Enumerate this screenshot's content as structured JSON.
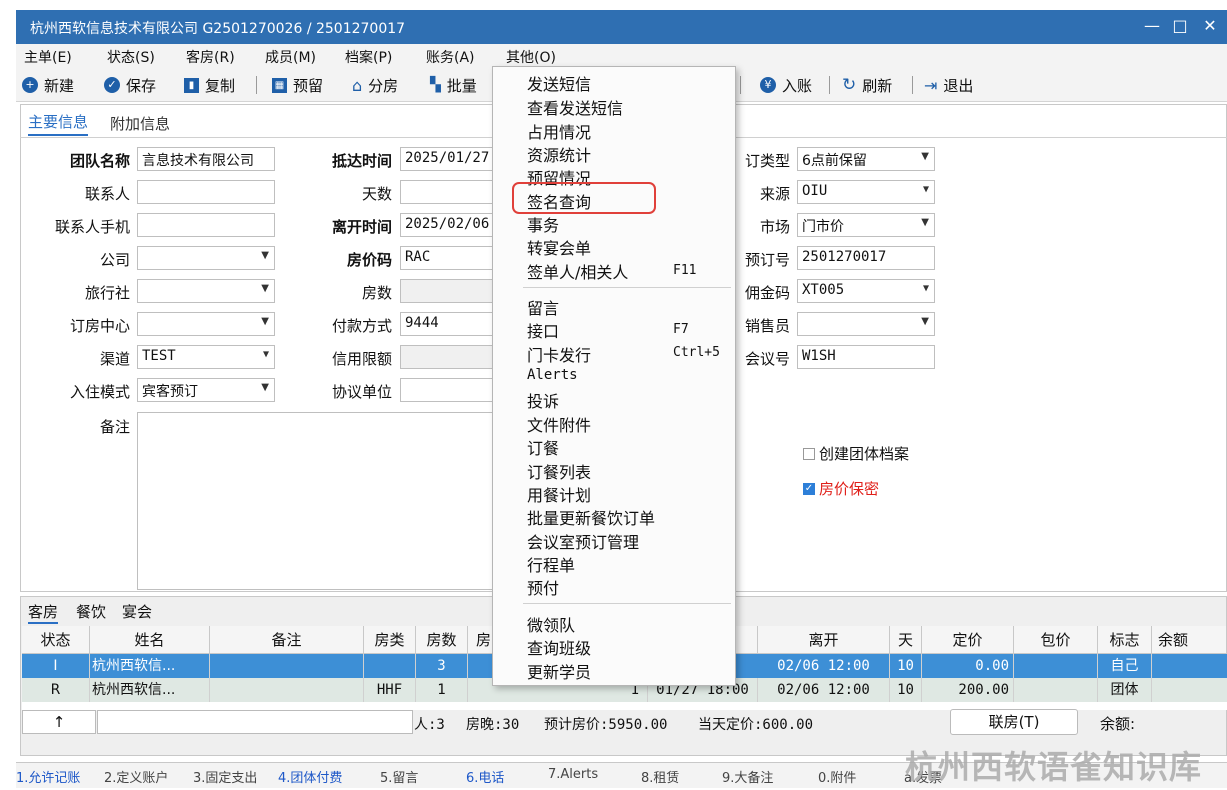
{
  "window": {
    "title": "杭州西软信息技术有限公司  G2501270026 / 2501270017",
    "min": "—",
    "max": "□",
    "close": "✕"
  },
  "menubar": [
    "主单(E)",
    "状态(S)",
    "客房(R)",
    "成员(M)",
    "档案(P)",
    "账务(A)",
    "其他(O)"
  ],
  "toolbar": {
    "new": "新建",
    "save": "保存",
    "copy": "复制",
    "reserve": "预留",
    "assign": "分房",
    "batch": "批量",
    "post": "入账",
    "refresh": "刷新",
    "exit": "退出"
  },
  "top_tabs": [
    "主要信息",
    "附加信息"
  ],
  "form": {
    "group_name_label": "团队名称",
    "group_name_value": "言息技术有限公司",
    "contact_label": "联系人",
    "contact_value": "",
    "contact_phone_label": "联系人手机",
    "contact_phone_value": "",
    "company_label": "公司",
    "company_value": "",
    "agency_label": "旅行社",
    "agency_value": "",
    "booking_center_label": "订房中心",
    "booking_center_value": "",
    "channel_label": "渠道",
    "channel_value": "TEST",
    "checkin_mode_label": "入住模式",
    "checkin_mode_value": "宾客预订",
    "remark_label": "备注",
    "arrival_label": "抵达时间",
    "arrival_value": "2025/01/27",
    "days_label": "天数",
    "days_value": "",
    "departure_label": "离开时间",
    "departure_value": "2025/02/06",
    "rate_code_label": "房价码",
    "rate_code_value": "RAC",
    "rooms_label": "房数",
    "rooms_value": "",
    "payment_label": "付款方式",
    "payment_value": "9444",
    "credit_label": "信用限额",
    "credit_value": "",
    "agreement_label": "协议单位",
    "agreement_value": "",
    "booking_type_label": "订类型",
    "booking_type_value": "6点前保留",
    "source_label": "来源",
    "source_value": "OIU",
    "market_label": "市场",
    "market_value": "门市价",
    "resv_no_label": "预订号",
    "resv_no_value": "2501270017",
    "commission_label": "佣金码",
    "commission_value": "XT005",
    "sales_label": "销售员",
    "sales_value": "",
    "meeting_label": "会议号",
    "meeting_value": "W1SH",
    "create_profile_label": "创建团体档案",
    "rate_secret_label": "房价保密"
  },
  "lower_tabs": [
    "客房",
    "餐饮",
    "宴会"
  ],
  "grid": {
    "headers": [
      "状态",
      "姓名",
      "备注",
      "房类",
      "房数",
      "房",
      "离开",
      "天",
      "定价",
      "包价",
      "标志",
      "余额"
    ],
    "rows": [
      {
        "status": "I",
        "name": "杭州西软信...",
        "remark": "",
        "type": "",
        "count": "3",
        "n": "",
        "arrive": "",
        "depart": "02/06 12:00",
        "days": "10",
        "price": "0.00",
        "pkg": "",
        "flag": "自己",
        "bal": ""
      },
      {
        "status": "R",
        "name": "杭州西软信...",
        "remark": "",
        "type": "HHF",
        "count": "1",
        "n": "1",
        "arrive": "01/27 18:00",
        "depart": "02/06 12:00",
        "days": "10",
        "price": "200.00",
        "pkg": "",
        "flag": "团体",
        "bal": ""
      }
    ],
    "footer": {
      "up": "↑",
      "persons": "人:3",
      "nights": "房晚:30",
      "estimate": "预计房价:5950.00",
      "today": "当天定价:600.00",
      "link_button": "联房(T)",
      "balance": "余额:"
    }
  },
  "statusbar": [
    "1.允许记账",
    "2.定义账户",
    "3.固定支出",
    "4.团体付费",
    "5.留言",
    "6.电话",
    "7.Alerts",
    "8.租赁",
    "9.大备注",
    "0.附件",
    "a.发票"
  ],
  "menu": {
    "items": [
      "发送短信",
      "查看发送短信",
      "占用情况",
      "资源统计",
      "预留情况",
      "签名查询",
      "事务",
      "转宴会单",
      "签单人/相关人",
      "留言",
      "接口",
      "门卡发行",
      "Alerts",
      "投诉",
      "文件附件",
      "订餐",
      "订餐列表",
      "用餐计划",
      "批量更新餐饮订单",
      "会议室预订管理",
      "行程单",
      "预付",
      "微领队",
      "查询班级",
      "更新学员"
    ],
    "shortcuts": {
      "signer": "F11",
      "interface": "F7",
      "card": "Ctrl+5"
    }
  },
  "watermark": "杭州西软语雀知识库",
  "colors": {
    "titlebar": "#2f6fb2",
    "selected_row": "#3d8fd6",
    "highlight": "#e0403a",
    "link_blue": "#1e58c8"
  }
}
